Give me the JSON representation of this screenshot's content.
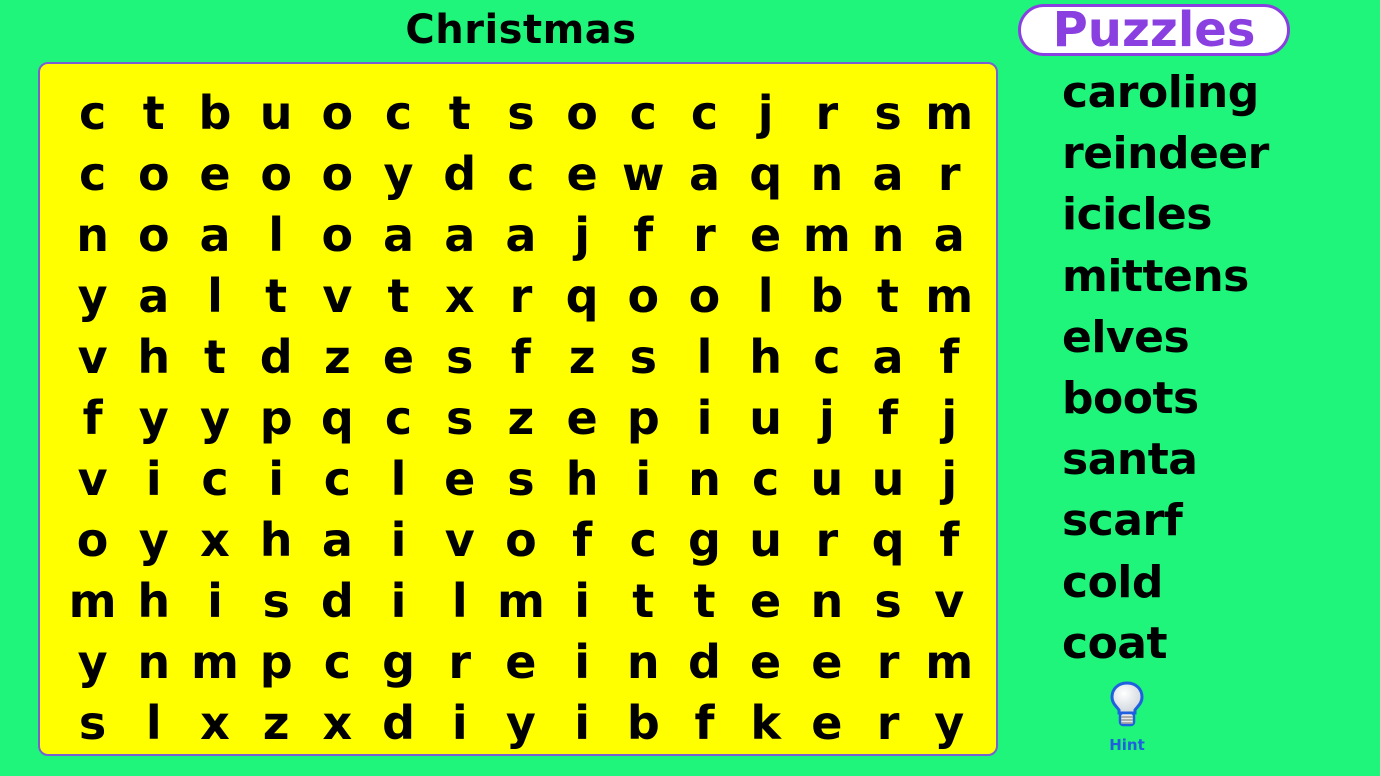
{
  "puzzle": {
    "title": "Christmas",
    "grid_rows": [
      "ctbuoctsoccjrsm",
      "coeooydcewaqnar",
      "noaloaaajfremna",
      "yaltvtxrqoolbtm",
      "vhtdzesfzslhcaf",
      "fyypqcszepiujfj",
      "vicicleshincuuj",
      "oyxhaivofcgurqf",
      "mhisdilmittensv",
      "ynmpcgreindeerm",
      "slxzxdiyibfkery"
    ]
  },
  "brand": {
    "label": "Puzzles"
  },
  "word_list": [
    "caroling",
    "reindeer",
    "icicles",
    "mittens",
    "elves",
    "boots",
    "santa",
    "scarf",
    "cold",
    "coat"
  ],
  "hint": {
    "label": "Hint",
    "icon": "lightbulb-icon"
  },
  "colors": {
    "background": "#1ff57a",
    "board": "#ffff00",
    "brand_purple": "#8a3fe0",
    "hint_blue": "#1f5fe0"
  }
}
